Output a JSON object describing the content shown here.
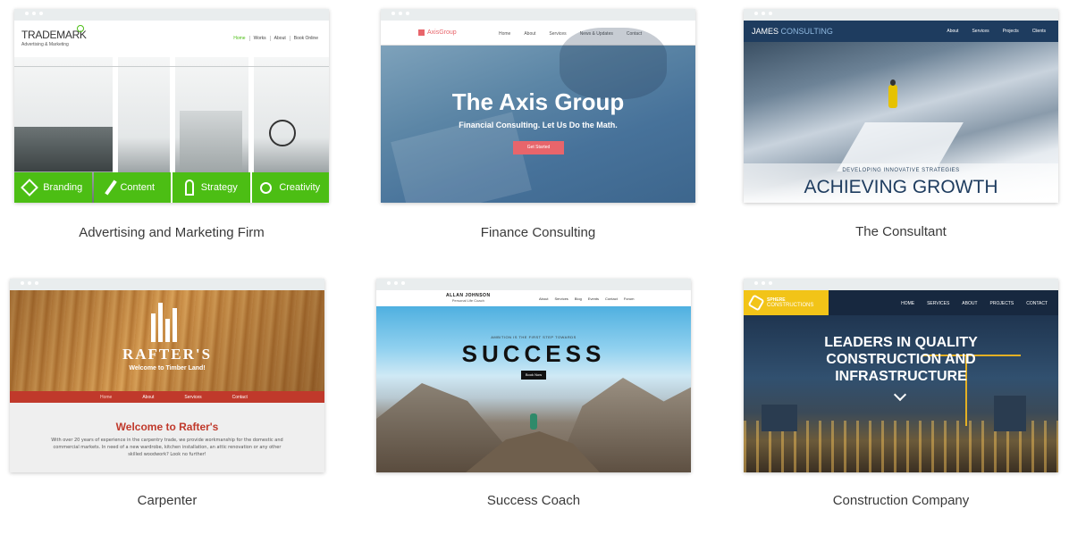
{
  "templates": [
    {
      "caption": "Advertising and Marketing Firm",
      "logo_title": "TRADEMARK",
      "logo_sub": "Advertising & Marketing",
      "nav": [
        "Home",
        "Works",
        "About",
        "Book Online"
      ],
      "features": [
        "Branding",
        "Content",
        "Strategy",
        "Creativity"
      ],
      "accent": "#4cbe14"
    },
    {
      "caption": "Finance Consulting",
      "logo": "AxisGroup",
      "nav": [
        "Home",
        "About",
        "Services",
        "News & Updates",
        "Contact"
      ],
      "headline": "The Axis Group",
      "subhead": "Financial Consulting. Let Us Do the Math.",
      "cta": "Get Started",
      "accent": "#e8656b"
    },
    {
      "caption": "The Consultant",
      "logo_a": "JAMES",
      "logo_b": "CONSULTING",
      "nav": [
        "About",
        "Services",
        "Projects",
        "Clients"
      ],
      "tagline": "DEVELOPING INNOVATIVE STRATEGIES",
      "headline": "ACHIEVING GROWTH",
      "accent": "#1e3c5f"
    },
    {
      "caption": "Carpenter",
      "brand": "RAFTER'S",
      "subtitle": "Welcome to Timber Land!",
      "nav": [
        "Home",
        "About",
        "Services",
        "Contact"
      ],
      "heading": "Welcome to Rafter's",
      "body": "With over 20 years of experience in the carpentry trade, we provide workmanship for the domestic and commercial markets. In need of a new wardrobe, kitchen installation, an attic renovation or any other skilled woodwork? Look no further!",
      "accent": "#c0392b"
    },
    {
      "caption": "Success Coach",
      "name": "ALLAN JOHNSON",
      "role": "Personal Life Coach",
      "nav": [
        "About",
        "Services",
        "Blog",
        "Events",
        "Contact",
        "Forum"
      ],
      "tagline": "AMBITION IS THE FIRST STEP TOWARDS",
      "headline": "SUCCESS",
      "cta": "Book Now"
    },
    {
      "caption": "Construction Company",
      "logo_a": "SPHERE",
      "logo_b": "CONSTRUCTIONS",
      "nav": [
        "HOME",
        "SERVICES",
        "ABOUT",
        "PROJECTS",
        "CONTACT"
      ],
      "headline": [
        "LEADERS IN QUALITY",
        "CONSTRUCTION AND",
        "INFRASTRUCTURE"
      ],
      "accent": "#f2c418"
    }
  ]
}
